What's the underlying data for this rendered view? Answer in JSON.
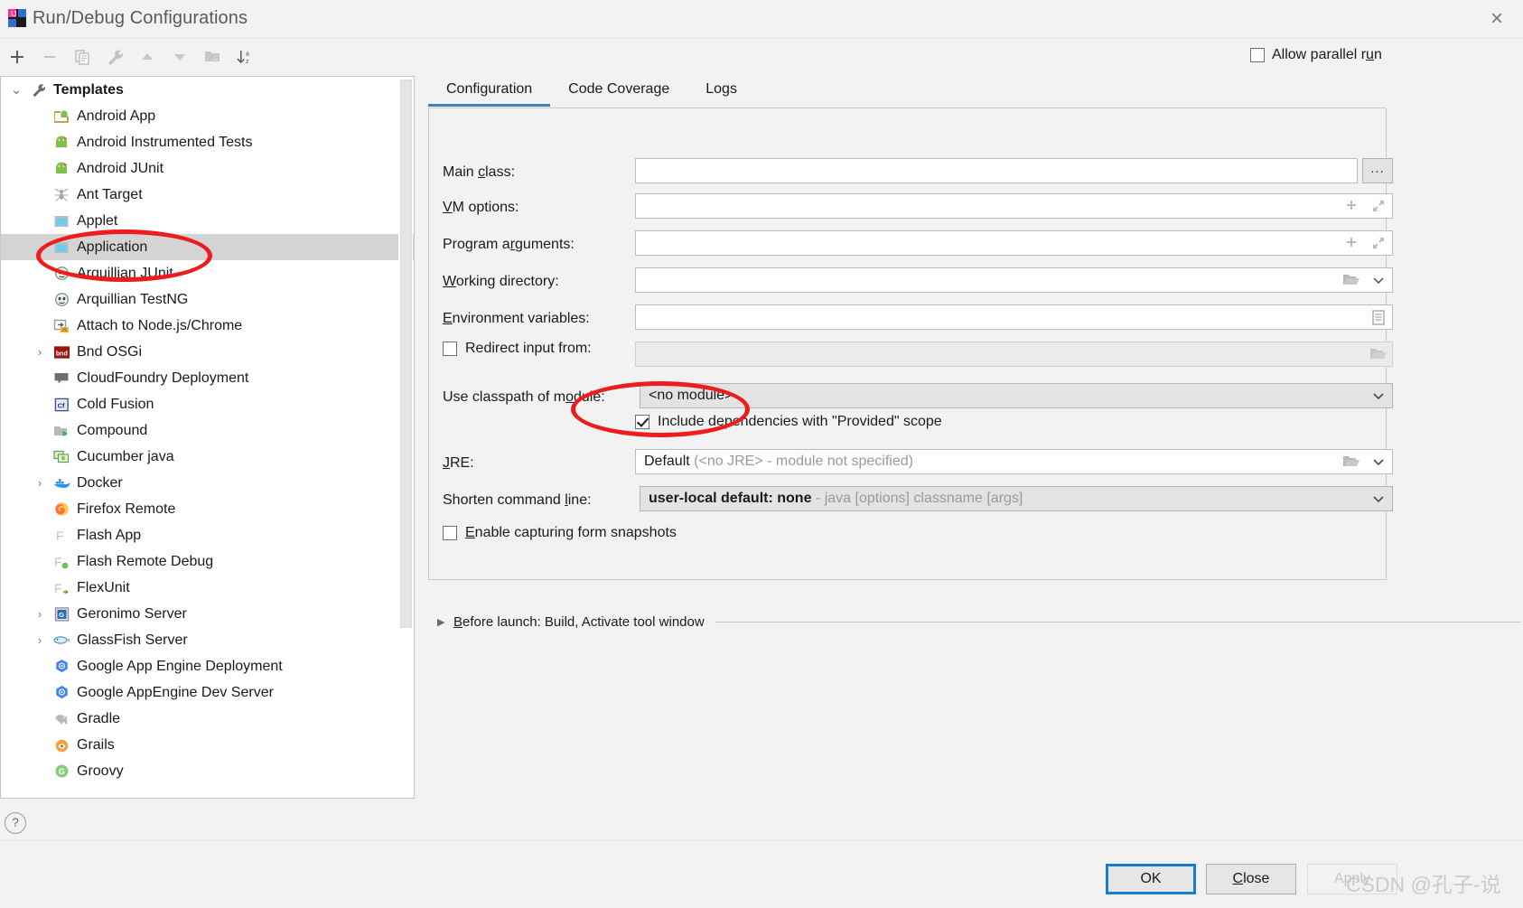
{
  "window": {
    "title": "Run/Debug Configurations",
    "app_icon": "intellij-idea-icon",
    "close_icon": "×"
  },
  "toolbar": {
    "buttons": [
      {
        "name": "add-configuration-button",
        "icon": "plus-icon",
        "glyph": "+",
        "enabled": true
      },
      {
        "name": "remove-configuration-button",
        "icon": "minus-icon",
        "glyph": "−",
        "enabled": false
      },
      {
        "name": "copy-configuration-button",
        "icon": "copy-icon",
        "glyph": "copy",
        "enabled": false
      },
      {
        "name": "edit-templates-button",
        "icon": "wrench-icon",
        "glyph": "wrench",
        "enabled": false
      },
      {
        "name": "move-up-button",
        "icon": "arrow-up-icon",
        "glyph": "▲",
        "enabled": false
      },
      {
        "name": "move-down-button",
        "icon": "arrow-down-icon",
        "glyph": "▼",
        "enabled": false
      },
      {
        "name": "create-folder-button",
        "icon": "folder-add-icon",
        "glyph": "folder+",
        "enabled": false
      },
      {
        "name": "sort-configurations-button",
        "icon": "sort-alpha-icon",
        "glyph": "sort",
        "enabled": true
      }
    ]
  },
  "allow_parallel_run": {
    "label": "Allow parallel r",
    "mnemonic": "u",
    "label_tail": "n",
    "checked": false
  },
  "tree": {
    "scrollbar": {
      "name": "tree-scrollbar"
    },
    "items": [
      {
        "label": "Templates",
        "icon": "wrench-icon",
        "indent": 0,
        "twisty": "⌄",
        "root": true,
        "selected": false
      },
      {
        "label": "Android App",
        "icon": "android-app-icon",
        "indent": 1,
        "twisty": "",
        "root": false,
        "selected": false
      },
      {
        "label": "Android Instrumented Tests",
        "icon": "android-tests-icon",
        "indent": 1,
        "twisty": "",
        "root": false,
        "selected": false
      },
      {
        "label": "Android JUnit",
        "icon": "android-junit-icon",
        "indent": 1,
        "twisty": "",
        "root": false,
        "selected": false
      },
      {
        "label": "Ant Target",
        "icon": "ant-icon",
        "indent": 1,
        "twisty": "",
        "root": false,
        "selected": false
      },
      {
        "label": "Applet",
        "icon": "applet-icon",
        "indent": 1,
        "twisty": "",
        "root": false,
        "selected": false
      },
      {
        "label": "Application",
        "icon": "application-icon",
        "indent": 1,
        "twisty": "",
        "root": false,
        "selected": true
      },
      {
        "label": "Arquillian JUnit",
        "icon": "arquillian-icon",
        "indent": 1,
        "twisty": "",
        "root": false,
        "selected": false
      },
      {
        "label": "Arquillian TestNG",
        "icon": "arquillian-icon",
        "indent": 1,
        "twisty": "",
        "root": false,
        "selected": false
      },
      {
        "label": "Attach to Node.js/Chrome",
        "icon": "attach-node-icon",
        "indent": 1,
        "twisty": "",
        "root": false,
        "selected": false
      },
      {
        "label": "Bnd OSGi",
        "icon": "bnd-osgi-icon",
        "indent": 1,
        "twisty": "›",
        "root": false,
        "selected": false
      },
      {
        "label": "CloudFoundry Deployment",
        "icon": "cloudfoundry-icon",
        "indent": 1,
        "twisty": "",
        "root": false,
        "selected": false
      },
      {
        "label": "Cold Fusion",
        "icon": "coldfusion-icon",
        "indent": 1,
        "twisty": "",
        "root": false,
        "selected": false
      },
      {
        "label": "Compound",
        "icon": "compound-icon",
        "indent": 1,
        "twisty": "",
        "root": false,
        "selected": false
      },
      {
        "label": "Cucumber java",
        "icon": "cucumber-icon",
        "indent": 1,
        "twisty": "",
        "root": false,
        "selected": false
      },
      {
        "label": "Docker",
        "icon": "docker-icon",
        "indent": 1,
        "twisty": "›",
        "root": false,
        "selected": false
      },
      {
        "label": "Firefox Remote",
        "icon": "firefox-icon",
        "indent": 1,
        "twisty": "",
        "root": false,
        "selected": false
      },
      {
        "label": "Flash App",
        "icon": "flash-icon",
        "indent": 1,
        "twisty": "",
        "root": false,
        "selected": false
      },
      {
        "label": "Flash Remote Debug",
        "icon": "flash-debug-icon",
        "indent": 1,
        "twisty": "",
        "root": false,
        "selected": false
      },
      {
        "label": "FlexUnit",
        "icon": "flexunit-icon",
        "indent": 1,
        "twisty": "",
        "root": false,
        "selected": false
      },
      {
        "label": "Geronimo Server",
        "icon": "geronimo-icon",
        "indent": 1,
        "twisty": "›",
        "root": false,
        "selected": false
      },
      {
        "label": "GlassFish Server",
        "icon": "glassfish-icon",
        "indent": 1,
        "twisty": "›",
        "root": false,
        "selected": false
      },
      {
        "label": "Google App Engine Deployment",
        "icon": "google-cloud-icon",
        "indent": 1,
        "twisty": "",
        "root": false,
        "selected": false
      },
      {
        "label": "Google AppEngine Dev Server",
        "icon": "google-cloud-icon",
        "indent": 1,
        "twisty": "",
        "root": false,
        "selected": false
      },
      {
        "label": "Gradle",
        "icon": "gradle-icon",
        "indent": 1,
        "twisty": "",
        "root": false,
        "selected": false
      },
      {
        "label": "Grails",
        "icon": "grails-icon",
        "indent": 1,
        "twisty": "",
        "root": false,
        "selected": false
      },
      {
        "label": "Groovy",
        "icon": "groovy-icon",
        "indent": 1,
        "twisty": "",
        "root": false,
        "selected": false
      }
    ]
  },
  "tabs": [
    {
      "label": "Configuration",
      "active": true
    },
    {
      "label": "Code Coverage",
      "active": false
    },
    {
      "label": "Logs",
      "active": false
    }
  ],
  "form": {
    "main_class": {
      "label_pre": "Main ",
      "mnemonic": "c",
      "label_post": "lass:",
      "value": "",
      "browse": "..."
    },
    "vm_options": {
      "label_pre": "",
      "mnemonic": "V",
      "label_post": "M options:",
      "value": ""
    },
    "program_arguments": {
      "label_pre": "Program a",
      "mnemonic": "r",
      "label_post": "guments:",
      "value": ""
    },
    "working_directory": {
      "label_pre": "",
      "mnemonic": "W",
      "label_post": "orking directory:",
      "value": ""
    },
    "environment_variables": {
      "label_pre": "",
      "mnemonic": "E",
      "label_post": "nvironment variables:",
      "value": ""
    },
    "redirect_input": {
      "label": "Redirect input from:",
      "checked": false,
      "value": ""
    },
    "use_classpath": {
      "label_pre": "Use classpath of m",
      "mnemonic": "o",
      "label_post": "dule:",
      "value": "<no module>"
    },
    "include_provided": {
      "label": "Include dependencies with \"Provided\" scope",
      "checked": true
    },
    "jre": {
      "label_pre": "",
      "mnemonic": "J",
      "label_post": "RE:",
      "value_strong": "Default",
      "value_muted": "(<no JRE> - module not specified)"
    },
    "shorten_command_line": {
      "label_pre": "Shorten command ",
      "mnemonic": "l",
      "label_post": "ine:",
      "value_strong": "user-local default: none",
      "value_muted": "- java [options] classname [args]"
    },
    "enable_capturing": {
      "label_pre": "",
      "mnemonic": "E",
      "label_post": "nable capturing form snapshots",
      "checked": false
    }
  },
  "before_launch": {
    "mnemonic": "B",
    "label": "efore launch: Build, Activate tool window",
    "expanded": false,
    "triangle": "▶"
  },
  "footer": {
    "help_label": "?",
    "ok": {
      "label": "OK",
      "primary": true,
      "enabled": true
    },
    "close": {
      "label_pre": "",
      "mnemonic": "C",
      "label_post": "lose",
      "enabled": true
    },
    "apply": {
      "label": "Apply",
      "enabled": false
    }
  },
  "watermark": "CSDN @孔子-说",
  "colors": {
    "accent": "#3d7ebd",
    "focus_border": "#1a7bd4",
    "annotation": "#ee1c1c",
    "selection": "#d4d4d4",
    "dialog_bg": "#f2f2f2"
  }
}
